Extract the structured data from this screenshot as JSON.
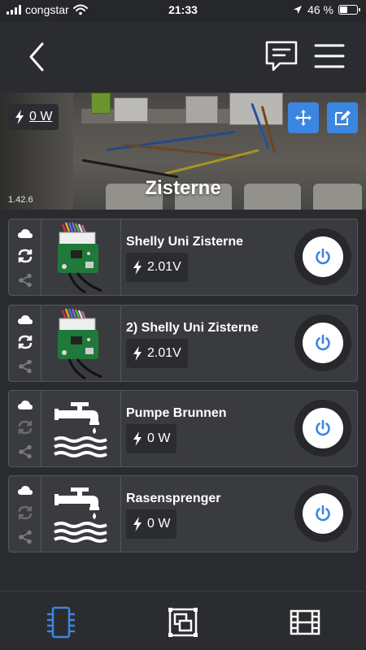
{
  "status": {
    "carrier": "congstar",
    "time": "21:33",
    "battery": "46 %",
    "battery_level": 0.46
  },
  "hero": {
    "power": "0 W",
    "title": "Zisterne",
    "version": "1.42.6"
  },
  "devices": [
    {
      "name": "Shelly Uni Zisterne",
      "value": "2.01V",
      "image": "shelly-uni-board",
      "synced": true
    },
    {
      "name": "2) Shelly Uni Zisterne",
      "value": "2.01V",
      "image": "shelly-uni-board",
      "synced": true
    },
    {
      "name": "Pumpe Brunnen",
      "value": "0 W",
      "image": "water-tap-icon",
      "synced": false
    },
    {
      "name": "Rasensprenger",
      "value": "0 W",
      "image": "water-tap-icon",
      "synced": false
    }
  ],
  "tabs": [
    {
      "icon": "device-chip-icon",
      "active": true
    },
    {
      "icon": "groups-icon",
      "active": false
    },
    {
      "icon": "scenes-film-icon",
      "active": false
    }
  ],
  "colors": {
    "accent": "#3b86e0",
    "background": "#2a2b2e",
    "card": "#3a3b3f"
  }
}
